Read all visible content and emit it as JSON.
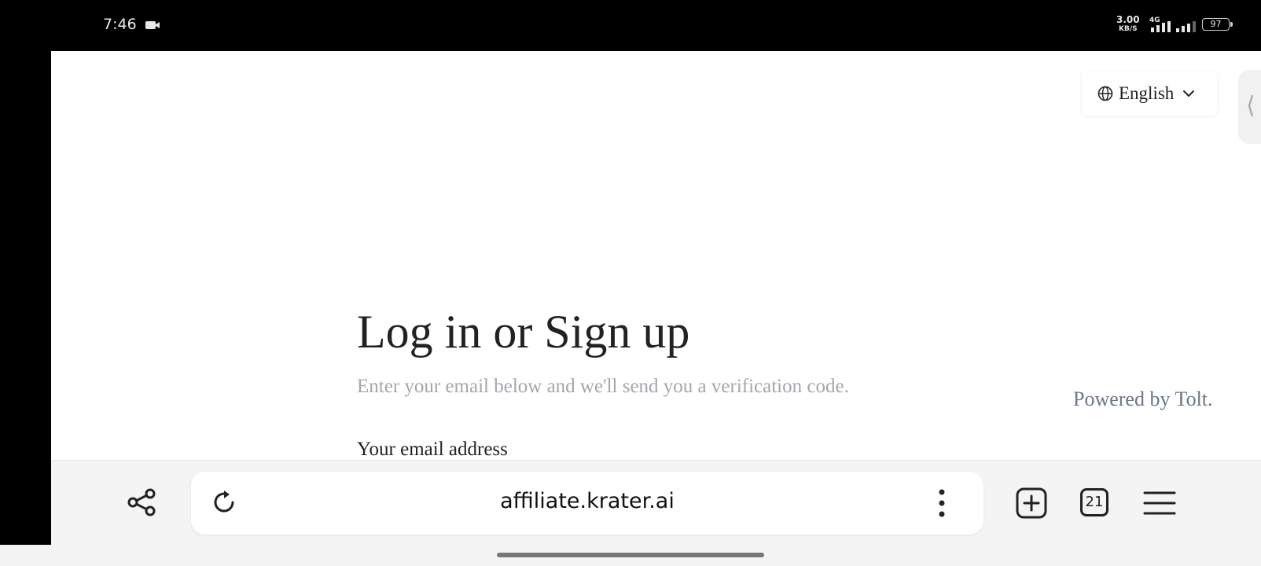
{
  "status_bar": {
    "time": "7:46",
    "speed_value": "3.00",
    "speed_unit": "KB/S",
    "network": "4G",
    "battery": "97"
  },
  "page": {
    "language": "English",
    "title": "Log in or Sign up",
    "subtitle": "Enter your email below and we'll send you a verification code.",
    "powered_by": "Powered by Tolt.",
    "email_label": "Your email address",
    "side_handle_glyph": "⟨"
  },
  "browser": {
    "url": "affiliate.krater.ai",
    "tab_count": "21"
  },
  "icons": {
    "camera": "video-camera-icon",
    "globe": "globe-icon",
    "chevron": "chevron-down-icon",
    "share": "share-icon",
    "reload": "reload-icon",
    "more": "more-vertical-icon",
    "new_tab": "new-tab-icon",
    "menu": "hamburger-menu-icon"
  },
  "colors": {
    "text_primary": "#222222",
    "text_muted": "#a2a7ae",
    "powered_by": "#6b7686",
    "status_bar": "#000000"
  }
}
